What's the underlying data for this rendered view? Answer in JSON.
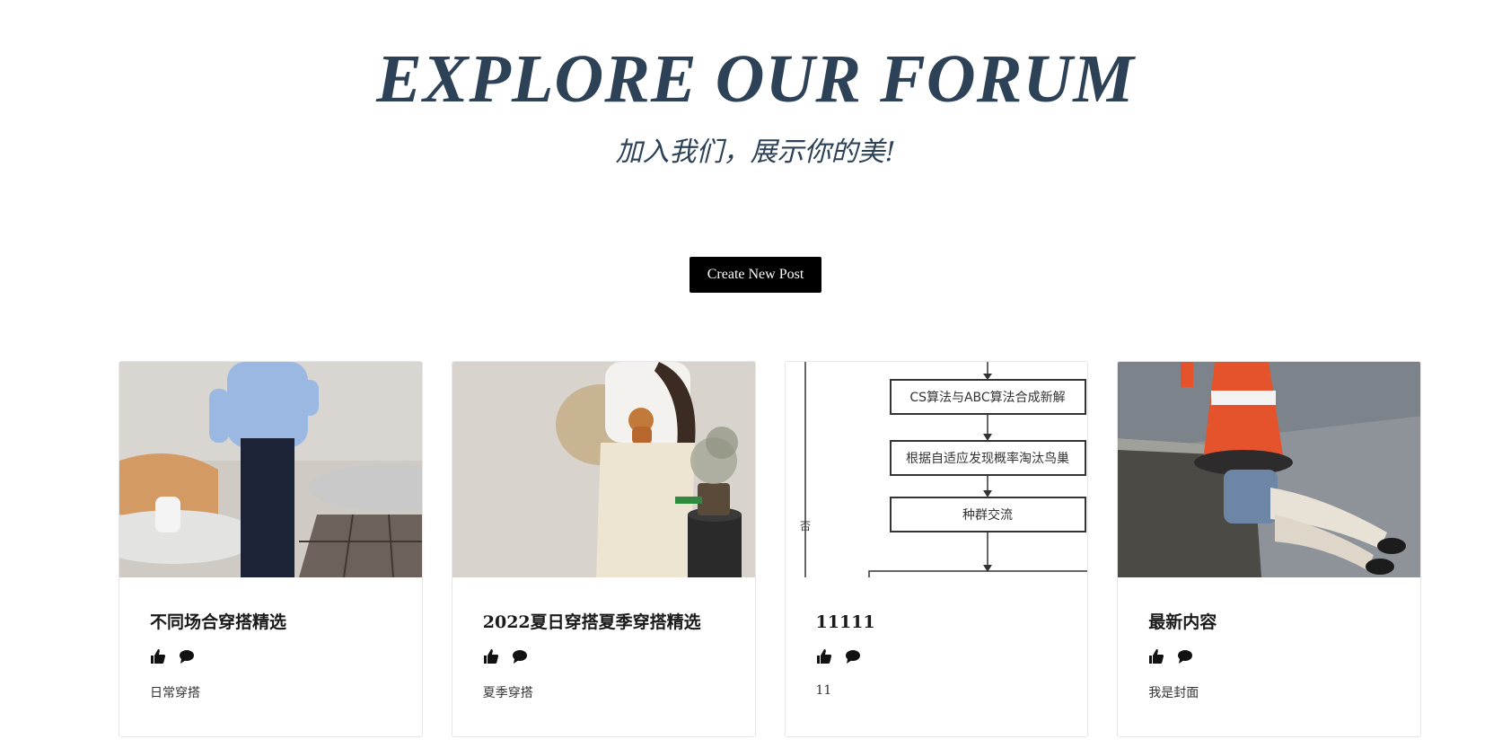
{
  "hero": {
    "title": "EXPLORE OUR FORUM",
    "subtitle": "加入我们，展示你的美!"
  },
  "create_button": {
    "label": "Create New Post"
  },
  "posts": [
    {
      "title": "不同场合穿搭精选",
      "description": "日常穿搭",
      "image": "woman-in-blue-shirt-photo"
    },
    {
      "title": "2022夏日穿搭夏季穿搭精选",
      "description": "夏季穿搭",
      "image": "woman-in-tshirt-skirt-photo"
    },
    {
      "title": "11111",
      "description": "11",
      "image": "flowchart-diagram",
      "flowchart": {
        "box1": "CS算法与ABC算法合成新解",
        "box2": "根据自适应发现概率淘汰鸟巢",
        "box3": "种群交流",
        "side_label": "否"
      }
    },
    {
      "title": "最新内容",
      "description": "我是封面",
      "image": "person-with-traffic-cone-photo"
    }
  ],
  "icons": {
    "like": "thumbs-up-icon",
    "comment": "comment-icon"
  },
  "colors": {
    "heading": "#2d4257",
    "button_bg": "#000000",
    "button_text": "#ffffff"
  }
}
